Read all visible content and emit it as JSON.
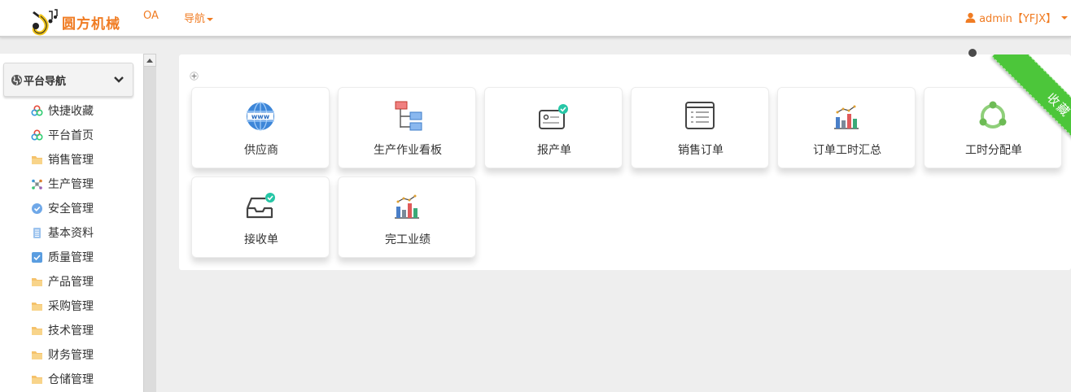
{
  "header": {
    "brand": "圆方机械",
    "nav": [
      {
        "label": "OA"
      },
      {
        "label": "导航"
      }
    ],
    "user": "admin【YFJX】"
  },
  "sidebar": {
    "title": "平台导航",
    "items": [
      {
        "label": "快捷收藏",
        "icon": "flower-icon"
      },
      {
        "label": "平台首页",
        "icon": "flower-icon"
      },
      {
        "label": "销售管理",
        "icon": "folder-icon"
      },
      {
        "label": "生产管理",
        "icon": "network-icon"
      },
      {
        "label": "安全管理",
        "icon": "shield-check-icon"
      },
      {
        "label": "基本资料",
        "icon": "document-icon"
      },
      {
        "label": "质量管理",
        "icon": "checkbox-icon"
      },
      {
        "label": "产品管理",
        "icon": "folder-icon"
      },
      {
        "label": "采购管理",
        "icon": "folder-icon"
      },
      {
        "label": "技术管理",
        "icon": "folder-icon"
      },
      {
        "label": "财务管理",
        "icon": "folder-icon"
      },
      {
        "label": "仓储管理",
        "icon": "folder-icon"
      }
    ]
  },
  "favorites": {
    "ribbon": "收藏",
    "tiles": [
      {
        "label": "供应商",
        "icon": "www-globe-icon"
      },
      {
        "label": "生产作业看板",
        "icon": "tree-diagram-icon"
      },
      {
        "label": "报产单",
        "icon": "card-check-icon"
      },
      {
        "label": "销售订单",
        "icon": "list-window-icon"
      },
      {
        "label": "订单工时汇总",
        "icon": "bar-chart-icon"
      },
      {
        "label": "工时分配单",
        "icon": "cycle-icon"
      },
      {
        "label": "接收单",
        "icon": "inbox-check-icon"
      },
      {
        "label": "完工业绩",
        "icon": "bar-chart-icon"
      }
    ]
  },
  "colors": {
    "accent": "#f07c23",
    "ribbon": "#4cc63a"
  }
}
